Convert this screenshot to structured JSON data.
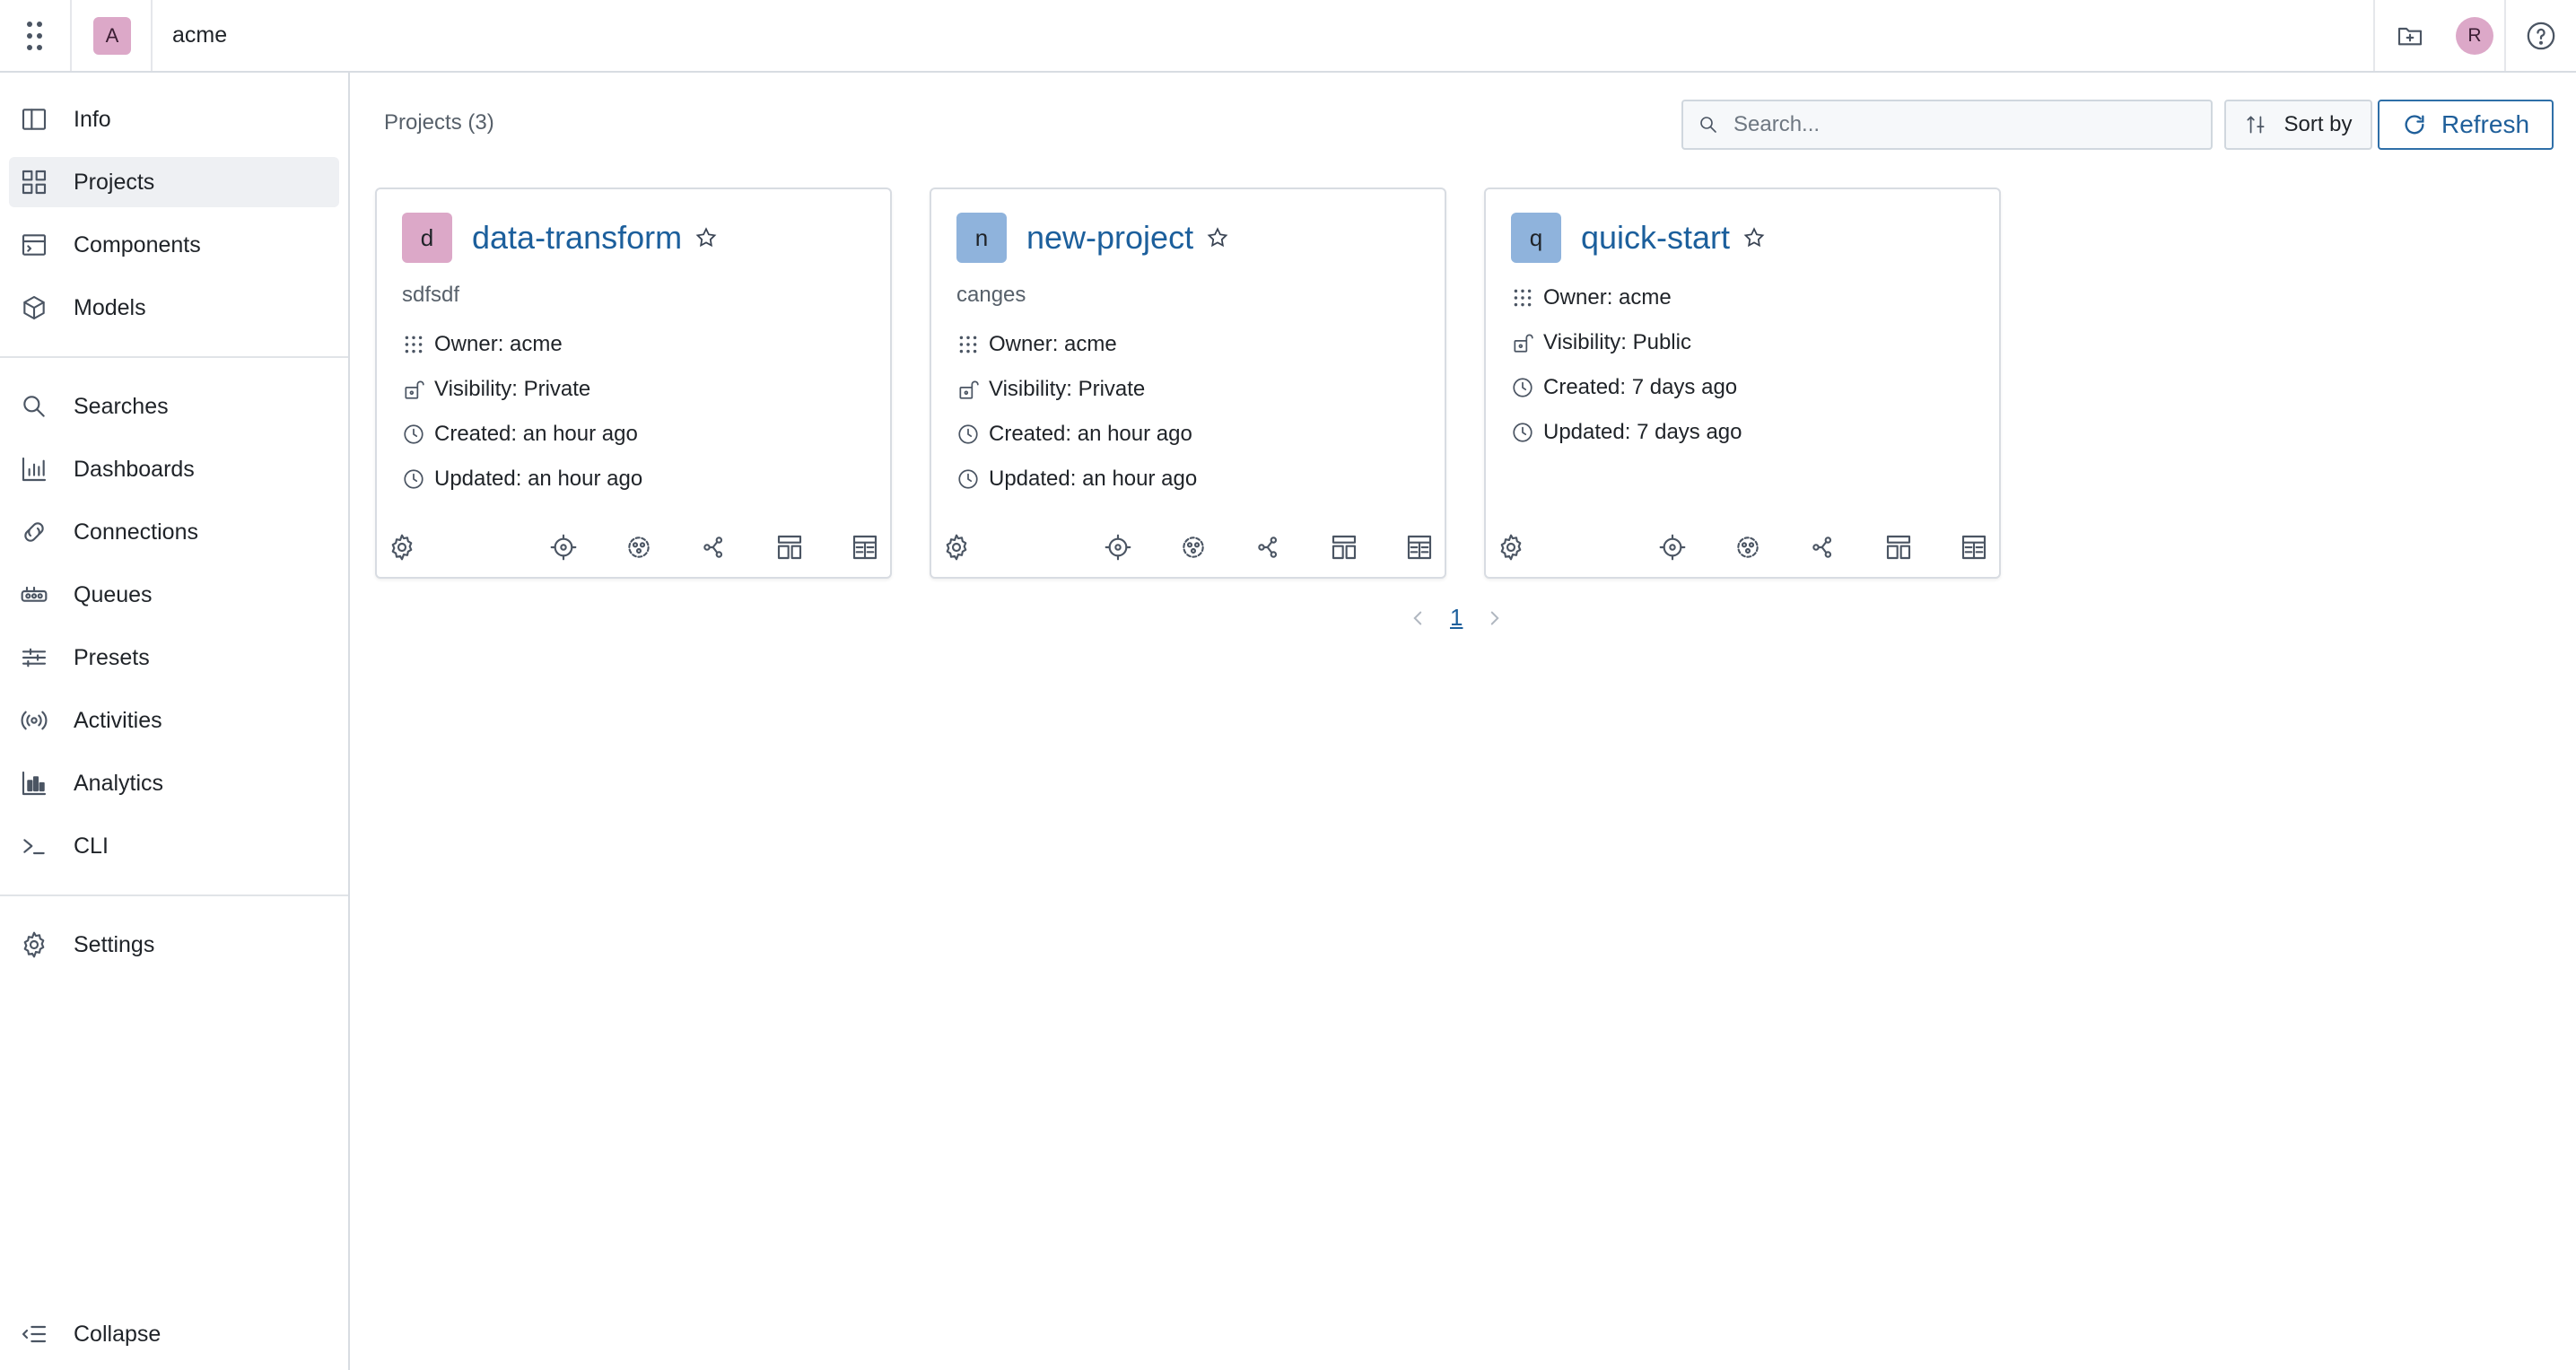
{
  "topbar": {
    "org_initial": "A",
    "org_name": "acme",
    "user_initial": "R"
  },
  "sidebar": {
    "groups": [
      [
        {
          "label": "Info",
          "icon": "book-icon"
        },
        {
          "label": "Projects",
          "icon": "grid-icon",
          "active": true
        },
        {
          "label": "Components",
          "icon": "component-icon"
        },
        {
          "label": "Models",
          "icon": "cube-icon"
        }
      ],
      [
        {
          "label": "Searches",
          "icon": "search-icon"
        },
        {
          "label": "Dashboards",
          "icon": "chart-icon"
        },
        {
          "label": "Connections",
          "icon": "link-icon"
        },
        {
          "label": "Queues",
          "icon": "queue-icon"
        },
        {
          "label": "Presets",
          "icon": "sliders-icon"
        },
        {
          "label": "Activities",
          "icon": "broadcast-icon"
        },
        {
          "label": "Analytics",
          "icon": "analytics-icon"
        },
        {
          "label": "CLI",
          "icon": "terminal-icon"
        }
      ],
      [
        {
          "label": "Settings",
          "icon": "gear-icon"
        }
      ]
    ],
    "collapse_label": "Collapse"
  },
  "main": {
    "projects_count": "Projects (3)",
    "search_placeholder": "Search...",
    "sort_label": "Sort by",
    "refresh_label": "Refresh",
    "accent": "#1c5f9c",
    "projects": [
      {
        "initial": "d",
        "name": "data-transform",
        "description": "sdfsdf",
        "avatar_color": "#dca8c8",
        "owner": "Owner: acme",
        "visibility": "Visibility: Private",
        "created": "Created: an hour ago",
        "updated": "Updated: an hour ago"
      },
      {
        "initial": "n",
        "name": "new-project",
        "description": "canges",
        "avatar_color": "#8fb3dc",
        "owner": "Owner: acme",
        "visibility": "Visibility: Private",
        "created": "Created: an hour ago",
        "updated": "Updated: an hour ago"
      },
      {
        "initial": "q",
        "name": "quick-start",
        "description": "",
        "avatar_color": "#8fb3dc",
        "owner": "Owner: acme",
        "visibility": "Visibility: Public",
        "created": "Created: 7 days ago",
        "updated": "Updated: 7 days ago"
      }
    ],
    "pagination": {
      "current_page": "1"
    }
  }
}
